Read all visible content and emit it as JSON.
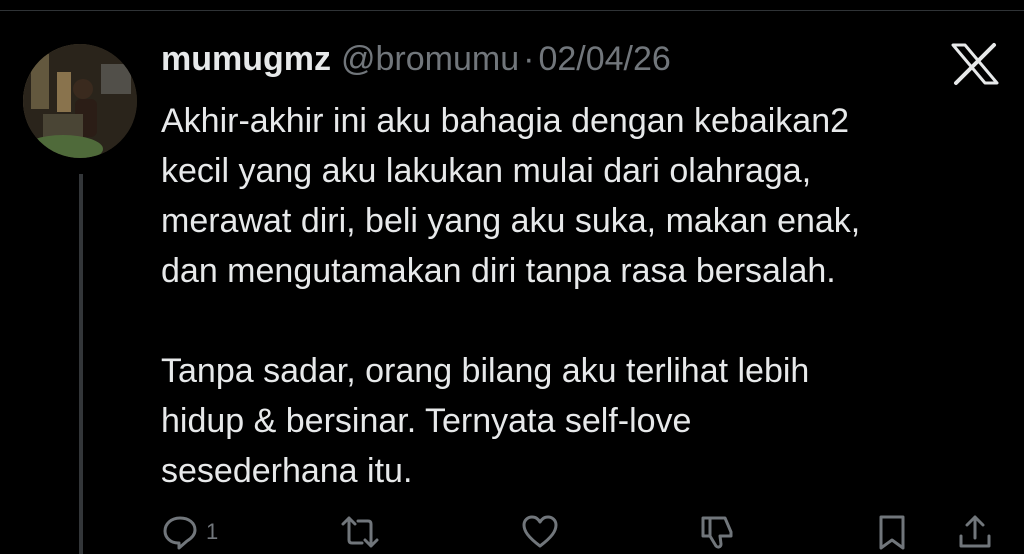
{
  "tweet": {
    "display_name": "mumugmz",
    "handle": "@bromumu",
    "separator": "·",
    "date": "02/04/26",
    "paragraphs": [
      [
        "Akhir-akhir ini aku bahagia dengan kebaikan2",
        "kecil yang aku lakukan mulai dari olahraga,",
        "merawat diri, beli yang aku suka, makan enak,",
        "dan mengutamakan diri tanpa rasa bersalah."
      ],
      [
        "Tanpa sadar, orang bilang aku terlihat lebih",
        "hidup & bersinar. Ternyata self-love",
        "sesederhana itu."
      ]
    ]
  },
  "actions": {
    "reply_count": "1",
    "icons": [
      "reply-icon",
      "retweet-icon",
      "like-icon",
      "dislike-icon",
      "bookmark-icon",
      "share-icon"
    ]
  },
  "colors": {
    "background": "#000000",
    "text_primary": "#e7e9ea",
    "text_secondary": "#71767b",
    "thread_line": "#333639"
  }
}
